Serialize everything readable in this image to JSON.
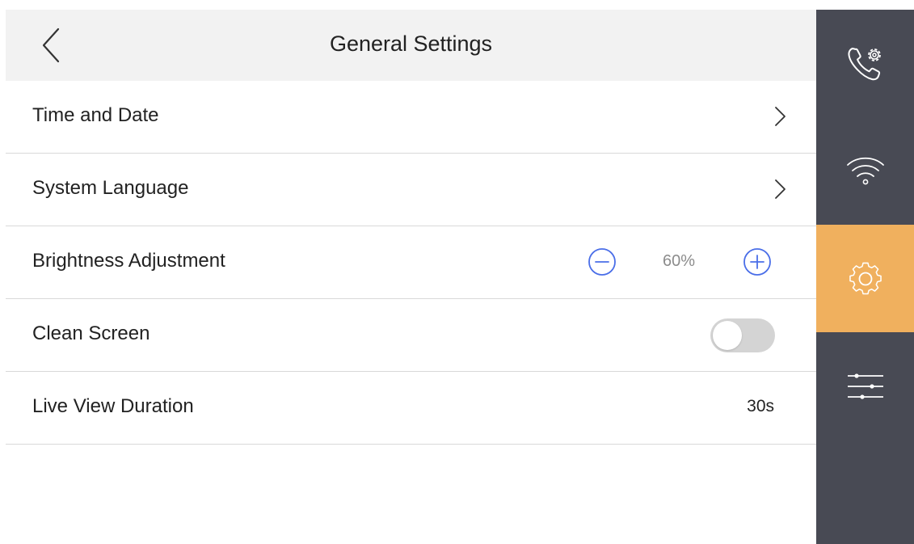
{
  "header": {
    "title": "General Settings",
    "back_icon": "chevron-left-icon"
  },
  "settings": {
    "time_and_date": {
      "label": "Time and Date",
      "icon": "chevron-right-icon"
    },
    "system_language": {
      "label": "System Language",
      "icon": "chevron-right-icon"
    },
    "brightness": {
      "label": "Brightness Adjustment",
      "value": "60%",
      "level": 60,
      "decrease_icon": "minus-circle-icon",
      "increase_icon": "plus-circle-icon"
    },
    "clean_screen": {
      "label": "Clean Screen",
      "enabled": false
    },
    "live_view_duration": {
      "label": "Live View Duration",
      "value": "30s"
    }
  },
  "sidebar": {
    "items": [
      {
        "icon": "phone-settings-icon",
        "active": false
      },
      {
        "icon": "wifi-icon",
        "active": false
      },
      {
        "icon": "gear-icon",
        "active": true
      },
      {
        "icon": "sliders-icon",
        "active": false
      }
    ]
  },
  "colors": {
    "header_bg": "#f2f2f2",
    "sidebar_bg": "#484a54",
    "sidebar_active": "#f0b05e",
    "stepper_accent": "#4a6ee8",
    "toggle_off": "#d4d4d4",
    "divider": "#d9d9d9"
  }
}
